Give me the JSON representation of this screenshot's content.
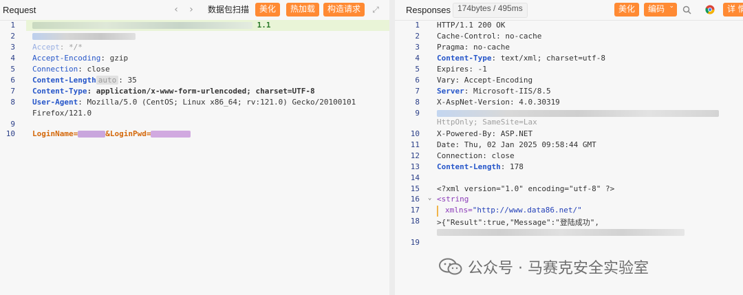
{
  "left": {
    "title": "Request",
    "scan_button": "数据包扫描",
    "buttons": [
      "美化",
      "热加载",
      "构造请求"
    ],
    "line1_suffix": "1.1",
    "headers": [
      {
        "ln": "1"
      },
      {
        "ln": "2"
      },
      {
        "ln": "3",
        "key": "Accept",
        "val": ": */*"
      },
      {
        "ln": "4",
        "key": "Accept-Encoding",
        "val": ": gzip"
      },
      {
        "ln": "5",
        "key": "Connection",
        "val": ": close"
      },
      {
        "ln": "6",
        "key": "Content-Length",
        "badge": "auto",
        "val": ": 35"
      },
      {
        "ln": "7",
        "key": "Content-Type",
        "val": ": application/x-www-form-urlencoded; charset=UTF-8"
      },
      {
        "ln": "8",
        "key": "User-Agent",
        "val": ": Mozilla/5.0 (CentOS; Linux x86_64; rv:121.0) Gecko/20100101"
      },
      {
        "ln": "",
        "val": "Firefox/121.0"
      },
      {
        "ln": "9"
      },
      {
        "ln": "10",
        "body1": "LoginName=",
        "body2": "&LoginPwd="
      }
    ]
  },
  "right": {
    "title": "Responses",
    "size_badge": "174bytes / 495ms",
    "buttons": [
      "美化",
      "编码"
    ],
    "detail_button": "详 情",
    "lines": [
      {
        "ln": "1",
        "text": "HTTP/1.1 200 OK"
      },
      {
        "ln": "2",
        "text": "Cache-Control: no-cache"
      },
      {
        "ln": "3",
        "text": "Pragma: no-cache"
      },
      {
        "ln": "4",
        "key": "Content-Type",
        "val": ": text/xml; charset=utf-8"
      },
      {
        "ln": "5",
        "text": "Expires: -1"
      },
      {
        "ln": "6",
        "text": "Vary: Accept-Encoding"
      },
      {
        "ln": "7",
        "key": "Server",
        "val": ": Microsoft-IIS/8.5"
      },
      {
        "ln": "8",
        "text": "X-AspNet-Version: 4.0.30319"
      },
      {
        "ln": "9",
        "text": ""
      },
      {
        "ln": "",
        "text": "HttpOnly; SameSite=Lax"
      },
      {
        "ln": "10",
        "text": "X-Powered-By: ASP.NET"
      },
      {
        "ln": "11",
        "text": "Date: Thu, 02 Jan 2025 09:58:44 GMT"
      },
      {
        "ln": "12",
        "text": "Connection: close"
      },
      {
        "ln": "13",
        "key": "Content-Length",
        "val": ": 178"
      },
      {
        "ln": "14",
        "text": ""
      },
      {
        "ln": "15",
        "text": "<?xml version=\"1.0\" encoding=\"utf-8\" ?>"
      },
      {
        "ln": "16",
        "text": "<string"
      },
      {
        "ln": "17",
        "attr": "xmlns=",
        "attrval": "\"http://www.data86.net/\""
      },
      {
        "ln": "18",
        "text": ">{\"Result\":true,\"Message\":\"登陆成功\","
      },
      {
        "ln": "",
        "text": ""
      },
      {
        "ln": "19",
        "text": ""
      }
    ]
  },
  "watermark": "公众号 · 马赛克安全实验室",
  "colors": {
    "orange_button": "#ff8a33",
    "key_blue": "#2656c9",
    "line_highlight": "#e9f4d7"
  }
}
